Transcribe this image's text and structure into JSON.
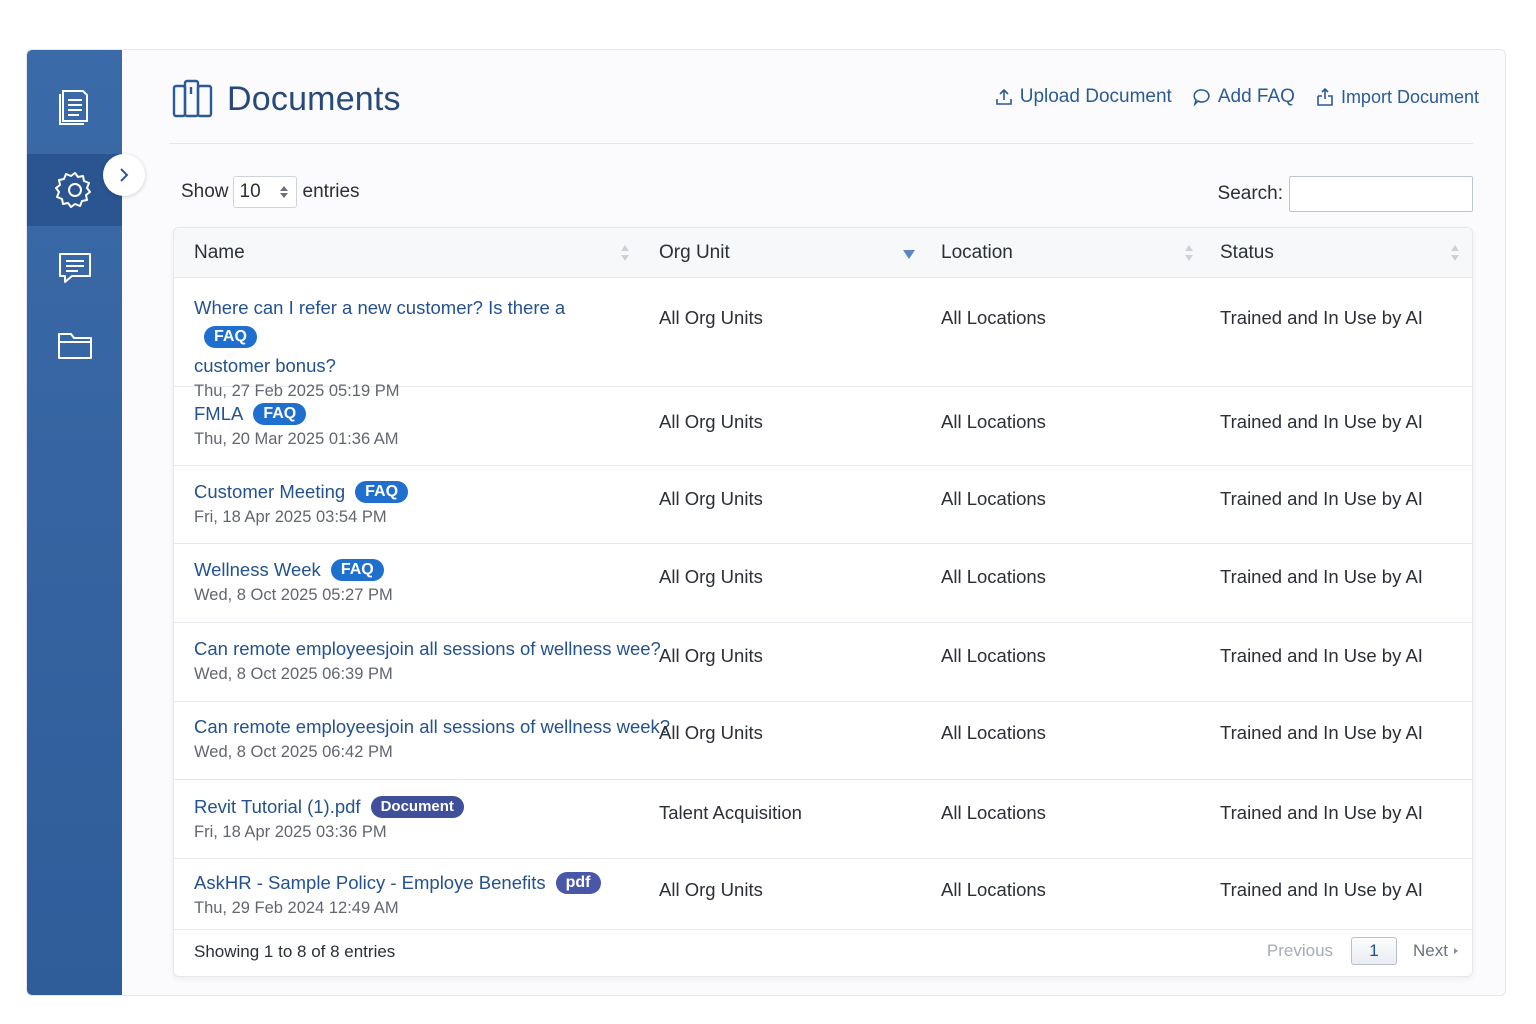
{
  "sidebar": {
    "items": [
      {
        "icon": "document-list-icon"
      },
      {
        "icon": "gear-icon"
      },
      {
        "icon": "chat-icon"
      },
      {
        "icon": "folder-icon"
      }
    ]
  },
  "header": {
    "title": "Documents",
    "actions": [
      {
        "label": "Upload Document",
        "icon": "upload-icon"
      },
      {
        "label": "Add FAQ",
        "icon": "chat-bubble-icon"
      },
      {
        "label": "Import Document",
        "icon": "import-icon"
      }
    ]
  },
  "controls": {
    "show_label": "Show",
    "entries_value": "10",
    "entries_label": "entries",
    "search_label": "Search:",
    "search_value": ""
  },
  "table": {
    "columns": [
      "Name",
      "Org Unit",
      "Location",
      "Status"
    ],
    "rows": [
      {
        "name_line1": "Where can I refer a new customer? Is there a",
        "name_line2": "customer bonus?",
        "badge": "FAQ",
        "date": "Thu, 27 Feb 2025 05:19 PM",
        "org_unit": "All Org Units",
        "location": "All Locations",
        "status": "Trained and In Use by AI"
      },
      {
        "name": "FMLA",
        "badge": "FAQ",
        "date": "Thu, 20 Mar 2025 01:36 AM",
        "org_unit": "All Org Units",
        "location": "All Locations",
        "status": "Trained and In Use by AI"
      },
      {
        "name": "Customer Meeting",
        "badge": "FAQ",
        "date": "Fri, 18 Apr 2025 03:54 PM",
        "org_unit": "All Org Units",
        "location": "All Locations",
        "status": "Trained and In Use by AI"
      },
      {
        "name": "Wellness Week",
        "badge": "FAQ",
        "date": "Wed, 8 Oct 2025 05:27 PM",
        "org_unit": "All Org Units",
        "location": "All Locations",
        "status": "Trained and In Use by AI"
      },
      {
        "name": "Can remote employeesjoin all sessions of wellness wee?",
        "badge": "",
        "date": "Wed, 8 Oct 2025 06:39 PM",
        "org_unit": "All Org Units",
        "location": "All Locations",
        "status": "Trained and In Use by AI"
      },
      {
        "name": "Can remote employeesjoin all sessions of wellness week?",
        "badge": "",
        "date": "Wed, 8 Oct 2025 06:42 PM",
        "org_unit": "All Org Units",
        "location": "All Locations",
        "status": "Trained and In Use by AI"
      },
      {
        "name": "Revit Tutorial (1).pdf",
        "badge": "Document",
        "date": "Fri, 18 Apr 2025 03:36 PM",
        "org_unit": "Talent Acquisition",
        "location": "All Locations",
        "status": "Trained and In Use by AI"
      },
      {
        "name": "AskHR - Sample Policy - Employe Benefits",
        "badge": "pdf",
        "date": "Thu, 29 Feb 2024 12:49 AM",
        "org_unit": "All Org Units",
        "location": "All Locations",
        "status": "Trained and In Use by AI"
      }
    ]
  },
  "footer": {
    "showing": "Showing 1 to 8 of 8 entries",
    "previous": "Previous",
    "page": "1",
    "next": "Next"
  },
  "colors": {
    "sidebar": "#3b6aa8",
    "accent": "#24528f",
    "faq_badge": "#1f6fcf",
    "doc_badge": "#3f4f9a"
  }
}
